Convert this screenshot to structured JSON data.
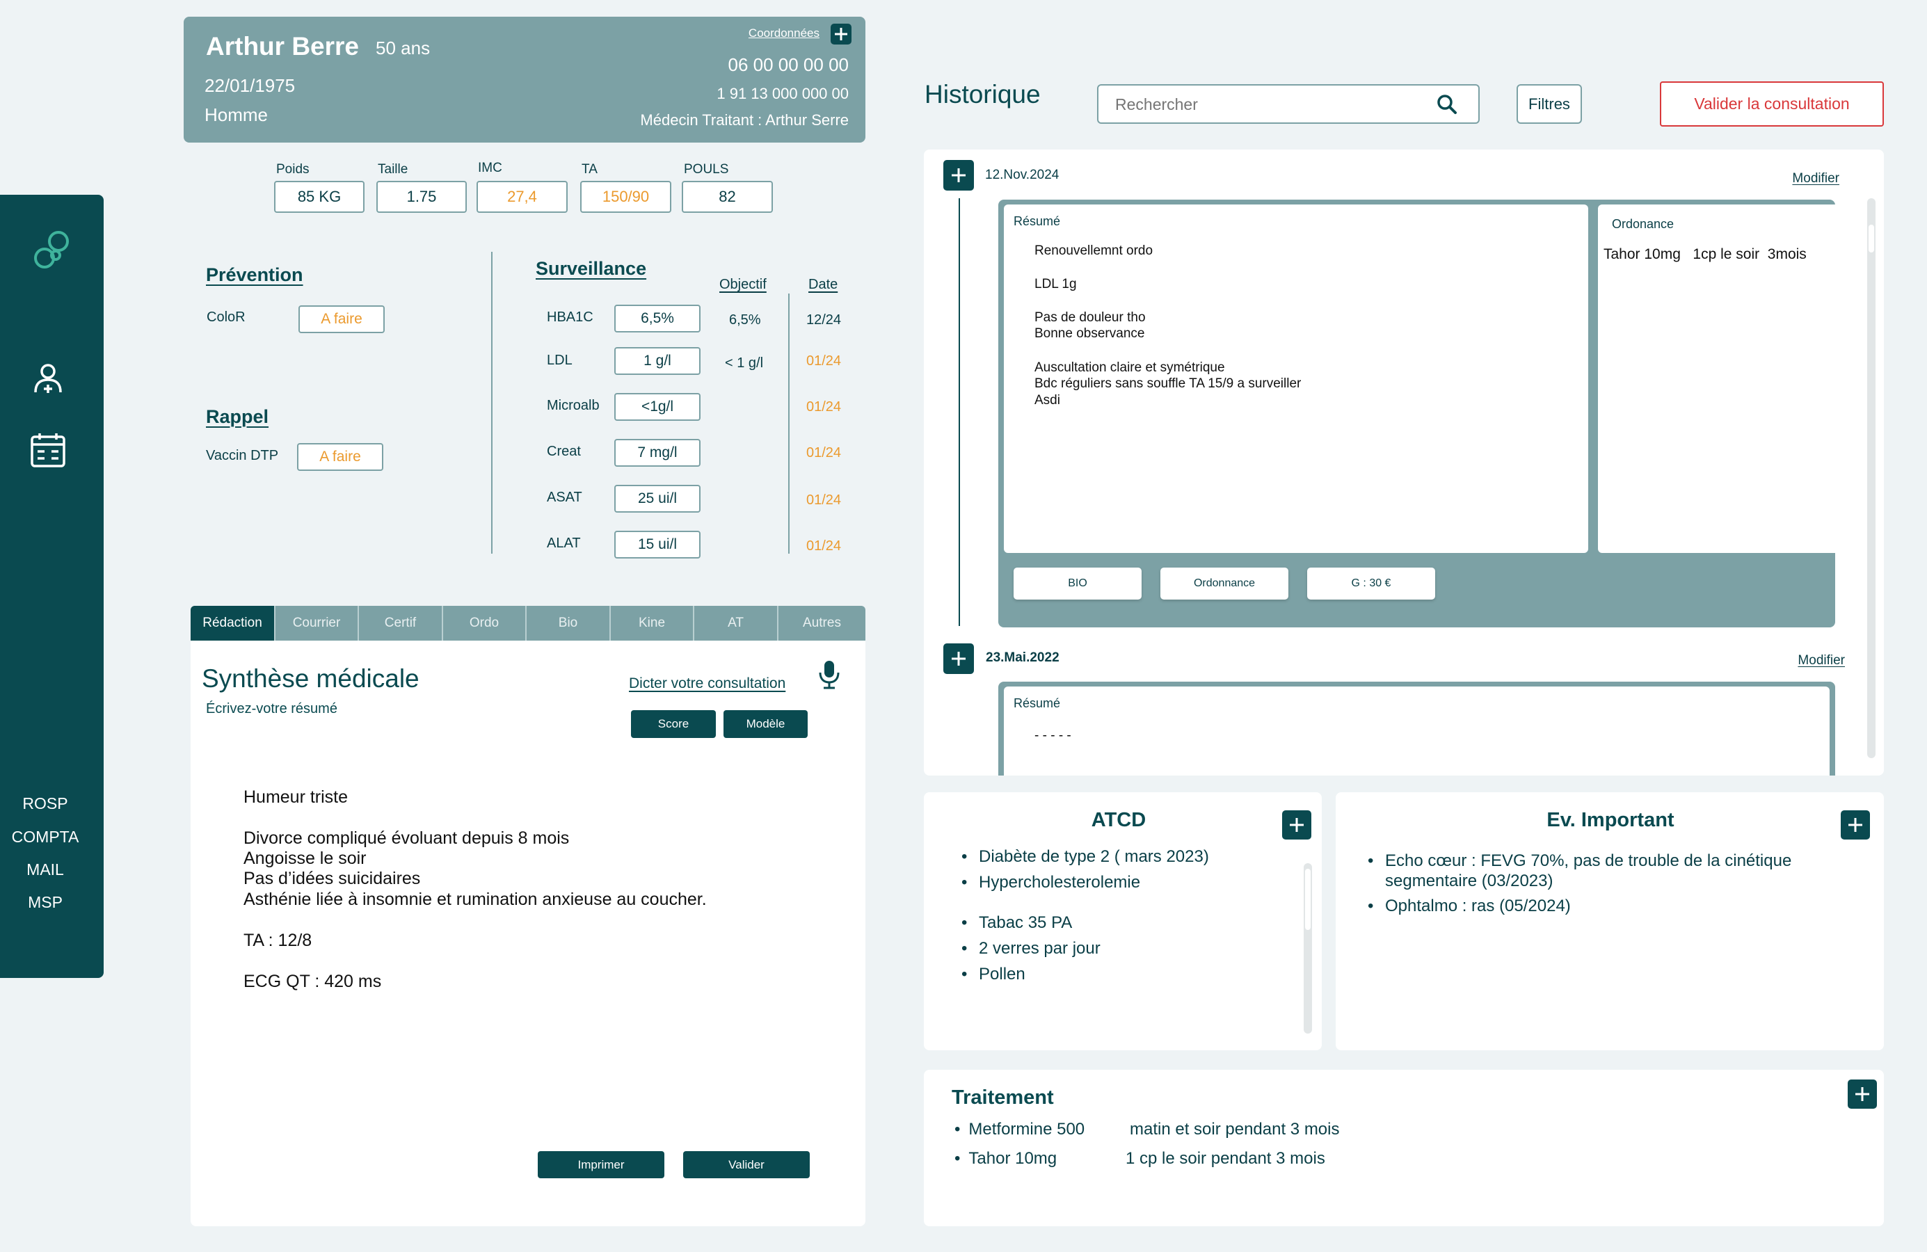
{
  "sidebar": {
    "links": [
      "ROSP",
      "COMPTA",
      "MAIL",
      "MSP"
    ]
  },
  "patient": {
    "name": "Arthur Berre",
    "age": "50 ans",
    "dob": "22/01/1975",
    "sex": "Homme",
    "coordinates_label": "Coordonnées",
    "phone": "06 00 00 00 00",
    "ssn": "1 91 13 000 000 00",
    "doctor": "Médecin Traitant : Arthur Serre"
  },
  "vitals": [
    {
      "label": "Poids",
      "value": "85  KG",
      "warn": false
    },
    {
      "label": "Taille",
      "value": "1.75",
      "warn": false
    },
    {
      "label": "IMC",
      "value": "27,4",
      "warn": true
    },
    {
      "label": "TA",
      "value": "150/90",
      "warn": true
    },
    {
      "label": "POULS",
      "value": "82",
      "warn": false
    }
  ],
  "prevention": {
    "title": "Prévention",
    "item_label": "ColoR",
    "item_status": "A faire"
  },
  "rappel": {
    "title": "Rappel",
    "item_label": "Vaccin DTP",
    "item_status": "A faire"
  },
  "surveillance": {
    "title": "Surveillance",
    "objective_header": "Objectif",
    "date_header": "Date",
    "rows": [
      {
        "label": "HBA1C",
        "value": "6,5%",
        "objective": "6,5%",
        "date": "12/24",
        "late": false
      },
      {
        "label": "LDL",
        "value": "1 g/l",
        "objective": "< 1 g/l",
        "date": "01/24",
        "late": true
      },
      {
        "label": "Microalb",
        "value": "<1g/l",
        "objective": "",
        "date": "01/24",
        "late": true
      },
      {
        "label": "Creat",
        "value": "7 mg/l",
        "objective": "",
        "date": "01/24",
        "late": true
      },
      {
        "label": "ASAT",
        "value": "25 ui/l",
        "objective": "",
        "date": "01/24",
        "late": true
      },
      {
        "label": "ALAT",
        "value": "15 ui/l",
        "objective": "",
        "date": "01/24",
        "late": true
      }
    ]
  },
  "tabs": [
    "Rédaction",
    "Courrier",
    "Certif",
    "Ordo",
    "Bio",
    "Kine",
    "AT",
    "Autres"
  ],
  "synthese": {
    "title": "Synthèse médicale",
    "subtitle": "Écrivez-votre résumé",
    "dictate_label": "Dicter votre consultation",
    "score_label": "Score",
    "model_label": "Modèle",
    "lines": [
      "Humeur triste",
      "Divorce compliqué évoluant depuis 8 mois",
      "Angoisse le soir",
      "Pas d’idées suicidaires",
      "Asthénie liée à insomnie et rumination anxieuse au coucher.",
      "TA : 12/8",
      "ECG QT : 420 ms"
    ],
    "print_label": "Imprimer",
    "validate_label": "Valider"
  },
  "historique": {
    "title": "Historique",
    "search_placeholder": "Rechercher",
    "filters_label": "Filtres",
    "validate_consult_label": "Valider la consultation",
    "entries": [
      {
        "date": "12.Nov.2024",
        "modify_label": "Modifier",
        "resume_label": "Résumé",
        "resume_lines": [
          "Renouvellemnt ordo",
          "LDL 1g",
          "Pas de douleur tho",
          "Bonne observance",
          "Auscultation claire et symétrique",
          "Bdc réguliers sans souffle TA 15/9 a surveiller",
          "Asdi"
        ],
        "ordonnance_label": "Ordonance",
        "ordonnance_text": "Tahor 10mg   1cp le soir  3mois",
        "buttons": [
          "BIO",
          "Ordonnance",
          "G : 30 €"
        ]
      },
      {
        "date": "23.Mai.2022",
        "modify_label": "Modifier",
        "resume_label": "Résumé",
        "resume_lines": [
          "- - - - -"
        ]
      }
    ]
  },
  "atcd": {
    "title": "ATCD",
    "items": [
      "Diabète de type 2 ( mars 2023)",
      "Hypercholesterolemie"
    ],
    "items2": [
      "Tabac 35 PA",
      "2 verres par jour",
      "Pollen"
    ]
  },
  "ev_important": {
    "title": "Ev. Important",
    "items": [
      "Echo cœur : FEVG 70%, pas de trouble de la cinétique",
      "segmentaire (03/2023)",
      "Ophtalmo : ras (05/2024)"
    ]
  },
  "traitement": {
    "title": "Traitement",
    "items": [
      {
        "drug": "Metformine 500",
        "dosage": "matin et soir pendant 3 mois"
      },
      {
        "drug": "Tahor 10mg",
        "dosage": "1 cp le soir pendant 3 mois"
      }
    ]
  },
  "colors": {
    "primary": "#0a4a50",
    "card": "#7ca1a5",
    "warning": "#eb9a2e",
    "danger": "#d9383a"
  }
}
